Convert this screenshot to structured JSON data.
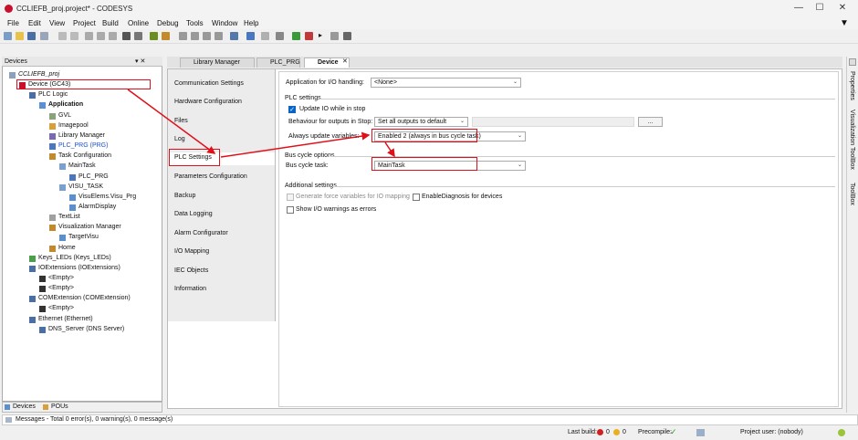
{
  "window": {
    "title": "CCLIEFB_proj.project* - CODESYS",
    "min": "—",
    "max": "☐",
    "close": "✕"
  },
  "menubar": [
    "File",
    "Edit",
    "View",
    "Project",
    "Build",
    "Online",
    "Debug",
    "Tools",
    "Window",
    "Help"
  ],
  "devices_panel": {
    "title": "Devices",
    "pin": "▾ ✕",
    "tree": [
      {
        "label": "CCLIEFB_proj",
        "indent": 0
      },
      {
        "label": "Device (GC43)",
        "indent": 1
      },
      {
        "label": "PLC Logic",
        "indent": 2
      },
      {
        "label": "Application",
        "indent": 3
      },
      {
        "label": "GVL",
        "indent": 4
      },
      {
        "label": "Imagepool",
        "indent": 4
      },
      {
        "label": "Library Manager",
        "indent": 4
      },
      {
        "label": "PLC_PRG (PRG)",
        "indent": 4
      },
      {
        "label": "Task Configuration",
        "indent": 4
      },
      {
        "label": "MainTask",
        "indent": 5
      },
      {
        "label": "PLC_PRG",
        "indent": 6
      },
      {
        "label": "VISU_TASK",
        "indent": 5
      },
      {
        "label": "VisuElems.Visu_Prg",
        "indent": 6
      },
      {
        "label": "AlarmDisplay",
        "indent": 6
      },
      {
        "label": "TextList",
        "indent": 4
      },
      {
        "label": "Visualization Manager",
        "indent": 4
      },
      {
        "label": "TargetVisu",
        "indent": 5
      },
      {
        "label": "Home",
        "indent": 4
      },
      {
        "label": "Keys_LEDs (Keys_LEDs)",
        "indent": 2
      },
      {
        "label": "IOExtensions (IOExtensions)",
        "indent": 2
      },
      {
        "label": "<Empty>",
        "indent": 3
      },
      {
        "label": "<Empty>",
        "indent": 3
      },
      {
        "label": "COMExtension (COMExtension)",
        "indent": 2
      },
      {
        "label": "<Empty>",
        "indent": 3
      },
      {
        "label": "Ethernet (Ethernet)",
        "indent": 2
      },
      {
        "label": "DNS_Server (DNS Server)",
        "indent": 3
      }
    ],
    "bottom_tabs": [
      "Devices",
      "POUs"
    ]
  },
  "editor_tabs": [
    "Library Manager",
    "PLC_PRG",
    "Device"
  ],
  "device_tabs": [
    "Communication Settings",
    "Hardware Configuration",
    "Files",
    "Log",
    "PLC Settings",
    "Parameters Configuration",
    "Backup",
    "Data Logging",
    "Alarm Configurator",
    "I/O Mapping",
    "IEC Objects",
    "Information"
  ],
  "plc_settings": {
    "app_io_label": "Application for I/O handling:",
    "app_io_value": "<None>",
    "plc_settings_header": "PLC settings",
    "update_io_label": "Update IO while in stop",
    "behaviour_label": "Behaviour for outputs in Stop:",
    "behaviour_value": "Set all outputs to default",
    "ellipsis": "...",
    "always_update_label": "Always update variables:",
    "always_update_value": "Enabled 2 (always in bus cycle task)",
    "bus_cycle_header": "Bus cycle options",
    "bus_cycle_label": "Bus cycle task:",
    "bus_cycle_value": "MainTask",
    "additional_header": "Additional settings",
    "gen_force_label": "Generate force variables for IO mapping",
    "enable_diag_label": "EnableDiagnosis for devices",
    "show_io_warn_label": "Show I/O warnings as errors"
  },
  "right_toolbox": [
    "Properties",
    "Visualization ToolBox",
    "ToolBox"
  ],
  "messages": "Messages - Total 0 error(s), 0 warning(s), 0 message(s)",
  "status": {
    "last_build_label": "Last build:",
    "errors": "0",
    "warnings": "0",
    "precompile_label": "Precompile:",
    "project_user": "Project user: (nobody)"
  }
}
